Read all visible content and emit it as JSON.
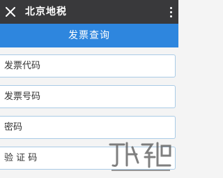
{
  "topbar": {
    "title": "北京地税",
    "close_icon": "close-icon",
    "more_icon": "more-vertical-icon"
  },
  "header": {
    "title": "发票查询",
    "color": "#2e86de"
  },
  "form": {
    "invoice_code_placeholder": "发票代码",
    "invoice_number_placeholder": "发票号码",
    "password_placeholder": "密码",
    "captcha_placeholder": "验 证 码"
  },
  "watermark": {
    "icon": "watermark-logo"
  }
}
